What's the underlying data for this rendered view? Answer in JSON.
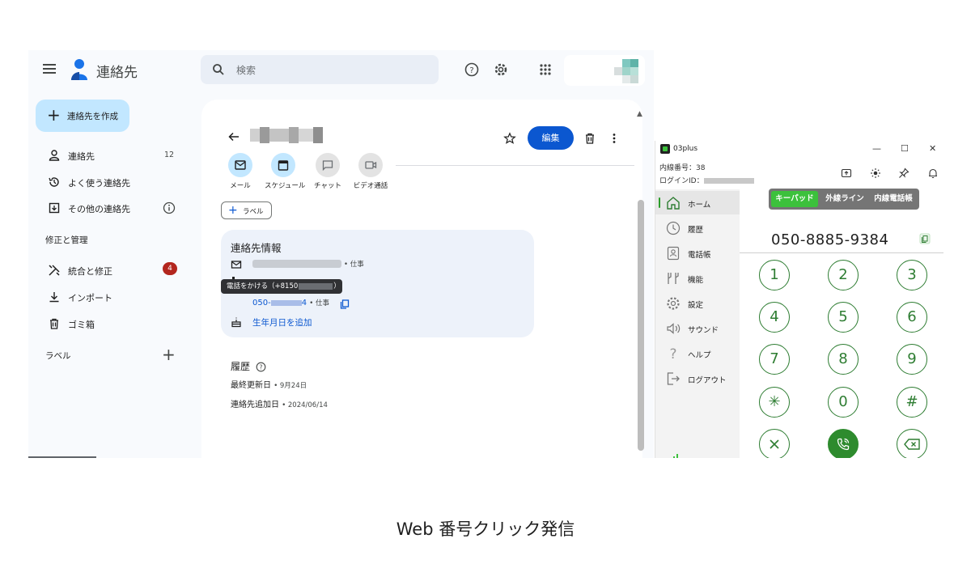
{
  "contacts": {
    "app_title": "連絡先",
    "search_placeholder": "検索",
    "create_label": "連絡先を作成",
    "nav": [
      {
        "label": "連絡先",
        "count": "12",
        "icon": "person-icon"
      },
      {
        "label": "よく使う連絡先",
        "icon": "history-icon"
      },
      {
        "label": "その他の連絡先",
        "icon": "archive-icon"
      }
    ],
    "manage_heading": "修正と管理",
    "manage": [
      {
        "label": "統合と修正",
        "badge": "4",
        "icon": "tools-icon"
      },
      {
        "label": "インポート",
        "icon": "download-icon"
      },
      {
        "label": "ゴミ箱",
        "icon": "trash-icon"
      }
    ],
    "labels_heading": "ラベル",
    "detail": {
      "edit_label": "編集",
      "actions": [
        {
          "label": "メール",
          "icon": "mail-icon"
        },
        {
          "label": "スケジュール",
          "icon": "calendar-icon"
        },
        {
          "label": "チャット",
          "icon": "chat-icon"
        },
        {
          "label": "ビデオ通話",
          "icon": "video-icon"
        }
      ],
      "label_button": "ラベル",
      "info_title": "連絡先情報",
      "email_tag": "• 仕事",
      "tooltip": "電話をかける（+8150",
      "tooltip_end": "）",
      "phone_prefix": "050-",
      "phone_suffix": "4",
      "phone_tag": "• 仕事",
      "birthday_link": "生年月日を追加",
      "history_title": "履歴",
      "last_updated_label": "最終更新日",
      "last_updated_value": "• 9月24日",
      "added_label": "連絡先追加日",
      "added_value": "• 2024/06/14"
    }
  },
  "phone_app": {
    "title": "03plus",
    "ext_label": "内線番号：38",
    "login_label": "ログインID：",
    "nav": [
      {
        "label": "ホーム",
        "icon": "home-icon"
      },
      {
        "label": "履歴",
        "icon": "clock-icon"
      },
      {
        "label": "電話帳",
        "icon": "phonebook-icon"
      },
      {
        "label": "機能",
        "icon": "tools-icon"
      },
      {
        "label": "設定",
        "icon": "gear-icon"
      },
      {
        "label": "サウンド",
        "icon": "speaker-icon"
      },
      {
        "label": "ヘルプ",
        "icon": "question-icon"
      },
      {
        "label": "ログアウト",
        "icon": "logout-icon"
      }
    ],
    "tabs": [
      "キーパッド",
      "外線ライン",
      "内線電話帳"
    ],
    "dialed_number": "050-8885-9384",
    "keys": [
      "1",
      "2",
      "3",
      "4",
      "5",
      "6",
      "7",
      "8",
      "9",
      "✳",
      "0",
      "#"
    ]
  },
  "caption": "Web 番号クリック発信",
  "colors": {
    "primary_blue": "#0b57d0",
    "accent_green": "#3cc13c",
    "call_green": "#2e8b2e",
    "badge_red": "#b3261e"
  }
}
